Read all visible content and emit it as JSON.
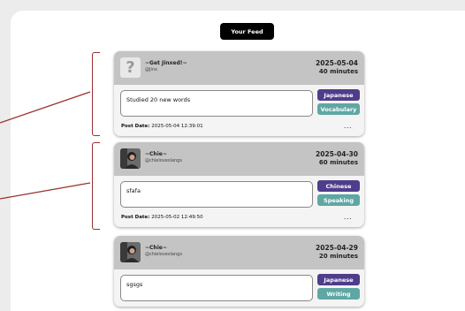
{
  "feed_button": "Your Feed",
  "post_date_label": "Post Date:",
  "posts": [
    {
      "user_name": "~Get Jinxed!~",
      "handle": "@Jinx",
      "avatar": "placeholder",
      "date": "2025-05-04",
      "duration": "40 minutes",
      "entry": "Studied 20 new words",
      "language": "Japanese",
      "category": "Vocabulary",
      "post_date": "2025-05-04 12:39:01",
      "more": "..."
    },
    {
      "user_name": "~Chie~",
      "handle": "@chielovesIangs",
      "avatar": "photo",
      "date": "2025-04-30",
      "duration": "60 minutes",
      "entry": "sfafa",
      "language": "Chinese",
      "category": "Speaking",
      "post_date": "2025-05-02 12:49:50",
      "more": "..."
    },
    {
      "user_name": "~Chie~",
      "handle": "@chielovesIangs",
      "avatar": "photo",
      "date": "2025-04-29",
      "duration": "20 minutes",
      "entry": "sgsgs",
      "language": "Japanese",
      "category": "Writing",
      "post_date": "",
      "more": ""
    }
  ],
  "colors": {
    "language_tag": "#4f3d8c",
    "category_tag": "#5fa7a4",
    "annotation": "#9b3030"
  }
}
